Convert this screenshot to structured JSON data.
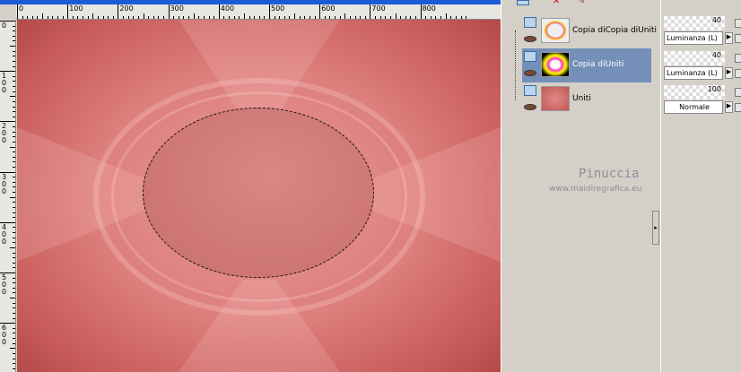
{
  "ruler": {
    "h_labels": [
      "0",
      "100",
      "200",
      "300",
      "400",
      "500",
      "600",
      "700",
      "800"
    ],
    "v_labels": [
      "0",
      "1\n0\n0",
      "2\n0\n0",
      "3\n0\n0",
      "4\n0\n0",
      "5\n0\n0",
      "6\n0\n0"
    ]
  },
  "layers": [
    {
      "name": "Copia diCopia diUniti",
      "selected": false,
      "opacity": "40",
      "blend": "Luminanza (L)"
    },
    {
      "name": "Copia diUniti",
      "selected": true,
      "opacity": "40",
      "blend": "Luminanza (L)"
    },
    {
      "name": "Uniti",
      "selected": false,
      "opacity": "100",
      "blend": "Normale"
    }
  ],
  "watermark": {
    "name": "Pinuccia",
    "url": "www.maidiregrafica.eu"
  },
  "colors": {
    "selection": "#7590b8",
    "canvas": "#dd7f7c"
  }
}
